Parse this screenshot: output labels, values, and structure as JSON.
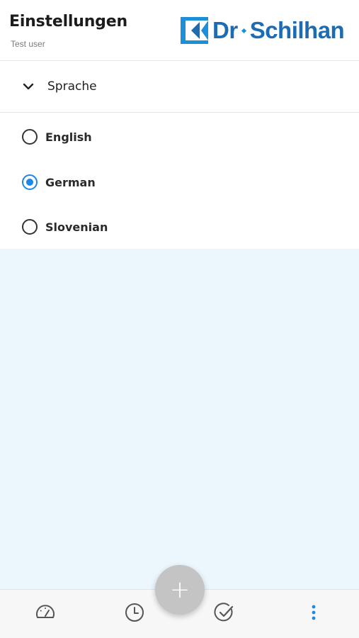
{
  "header": {
    "title": "Einstellungen",
    "subtitle": "Test user",
    "logo_text_left": "Dr",
    "logo_text_right": "Schilhan"
  },
  "language_section": {
    "title": "Sprache",
    "expanded": true,
    "options": [
      {
        "label": "English",
        "selected": false
      },
      {
        "label": "German",
        "selected": true
      },
      {
        "label": "Slovenian",
        "selected": false
      }
    ]
  },
  "fab": {
    "label": "+"
  },
  "bottom_nav": {
    "items": [
      {
        "icon": "speedometer-icon"
      },
      {
        "icon": "clock-icon"
      },
      {
        "icon": "check-circle-icon"
      },
      {
        "icon": "more-vertical-icon",
        "active": true
      }
    ]
  },
  "colors": {
    "brand": "#1d6cb3",
    "accent": "#1e88e5",
    "background": "#ebf7fd",
    "fab": "#c4c4c4"
  }
}
